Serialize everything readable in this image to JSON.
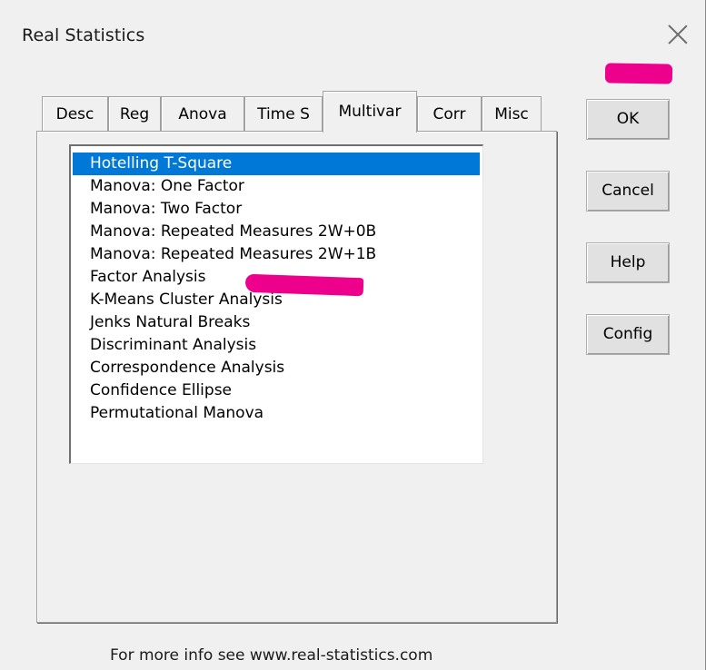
{
  "window": {
    "title": "Real Statistics",
    "close_icon": "close-icon"
  },
  "tabs": [
    {
      "label": "Desc",
      "active": false
    },
    {
      "label": "Reg",
      "active": false
    },
    {
      "label": "Anova",
      "active": false
    },
    {
      "label": "Time S",
      "active": false
    },
    {
      "label": "Multivar",
      "active": true
    },
    {
      "label": "Corr",
      "active": false
    },
    {
      "label": "Misc",
      "active": false
    }
  ],
  "list": {
    "selected_index": 0,
    "items": [
      "Hotelling T-Square",
      "Manova: One Factor",
      "Manova: Two Factor",
      "Manova: Repeated Measures 2W+0B",
      "Manova: Repeated Measures 2W+1B",
      "Factor Analysis",
      "K-Means Cluster Analysis",
      "Jenks Natural Breaks",
      "Discriminant Analysis",
      "Correspondence Analysis",
      "Confidence Ellipse",
      "Permutational Manova"
    ]
  },
  "buttons": {
    "ok": "OK",
    "cancel": "Cancel",
    "help": "Help",
    "config": "Config"
  },
  "footer": {
    "text": "For more info see www.real-statistics.com"
  },
  "colors": {
    "selection": "#0078d7",
    "annotation": "#ec008c",
    "background": "#f0f0f0"
  }
}
